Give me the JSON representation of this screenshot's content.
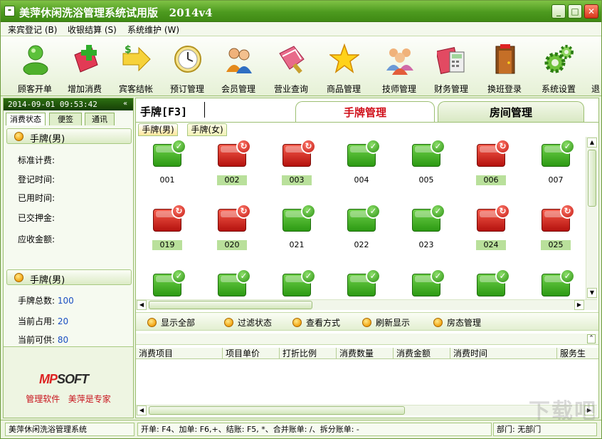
{
  "window": {
    "title": "美萍休闲洗浴管理系统试用版   2014v4",
    "min": "_",
    "max": "□",
    "close": "✕"
  },
  "menu": [
    {
      "label": "来宾登记 (B)"
    },
    {
      "label": "收银结算 (S)"
    },
    {
      "label": "系统维护 (W)"
    }
  ],
  "toolbar": [
    {
      "label": "顾客开单",
      "icon": "person-icon"
    },
    {
      "label": "增加消费",
      "icon": "add-icon"
    },
    {
      "label": "宾客结帐",
      "icon": "money-arrow-icon"
    },
    {
      "label": "预订管理",
      "icon": "clock-icon"
    },
    {
      "label": "会员管理",
      "icon": "members-icon"
    },
    {
      "label": "营业查询",
      "icon": "book-icon"
    },
    {
      "label": "商品管理",
      "icon": "star-icon"
    },
    {
      "label": "技师管理",
      "icon": "staff-icon"
    },
    {
      "label": "财务管理",
      "icon": "calculator-icon"
    },
    {
      "label": "换班登录",
      "icon": "exit-door-icon"
    },
    {
      "label": "系统设置",
      "icon": "gears-icon"
    },
    {
      "label": "退",
      "icon": "exit-icon"
    }
  ],
  "left": {
    "datetime": "2014-09-01 09:53:42",
    "collapse": "«",
    "tabs": [
      "消费状态",
      "便签",
      "通讯"
    ],
    "section1": {
      "title": "手牌(男)",
      "fields": [
        "标准计费:",
        "登记时间:",
        "已用时间:",
        "已交押金:",
        "应收金额:"
      ]
    },
    "section2": {
      "title": "手牌(男)",
      "fields": [
        {
          "label": "手牌总数:",
          "value": "100"
        },
        {
          "label": "当前占用:",
          "value": "20"
        },
        {
          "label": "当前可供:",
          "value": "80"
        }
      ]
    },
    "brand": {
      "logo_m": "MP",
      "logo_rest": "SOFT",
      "slogan": "管理软件   美萍是专家"
    }
  },
  "main": {
    "search_label": "手牌[F3]",
    "search_value": "",
    "tabs": [
      "手牌管理",
      "房间管理"
    ],
    "subtabs": [
      "手牌(男)",
      "手牌(女)"
    ],
    "cards": [
      {
        "num": "001",
        "status": "free"
      },
      {
        "num": "002",
        "status": "busy"
      },
      {
        "num": "003",
        "status": "busy"
      },
      {
        "num": "004",
        "status": "free"
      },
      {
        "num": "005",
        "status": "free"
      },
      {
        "num": "006",
        "status": "busy"
      },
      {
        "num": "007",
        "status": "free"
      },
      {
        "num": "019",
        "status": "busy"
      },
      {
        "num": "020",
        "status": "busy"
      },
      {
        "num": "021",
        "status": "free"
      },
      {
        "num": "022",
        "status": "free"
      },
      {
        "num": "023",
        "status": "free"
      },
      {
        "num": "024",
        "status": "busy"
      },
      {
        "num": "025",
        "status": "busy"
      },
      {
        "num": "",
        "status": "free"
      },
      {
        "num": "",
        "status": "free"
      },
      {
        "num": "",
        "status": "free"
      },
      {
        "num": "",
        "status": "free"
      },
      {
        "num": "",
        "status": "free"
      },
      {
        "num": "",
        "status": "free"
      },
      {
        "num": "",
        "status": "free"
      }
    ],
    "actions": [
      "显示全部",
      "过滤状态",
      "查看方式",
      "刷新显示",
      "房态管理"
    ],
    "consumption_columns": [
      "消费项目",
      "项目单价",
      "打折比例",
      "消费数量",
      "消费金额",
      "消费时间",
      "服务生"
    ]
  },
  "status": {
    "app": "美萍休闲洗浴管理系统",
    "hint": "开单: F4、加单: F6,+、结账: F5, *、合并账单: /、拆分账单: -",
    "dept": "部门: 无部门"
  },
  "colors": {
    "accent": "#4d9a1f",
    "free": "#2c9a13",
    "busy": "#c31a12",
    "active_tab": "#d0101a"
  },
  "watermark": "下载吧"
}
